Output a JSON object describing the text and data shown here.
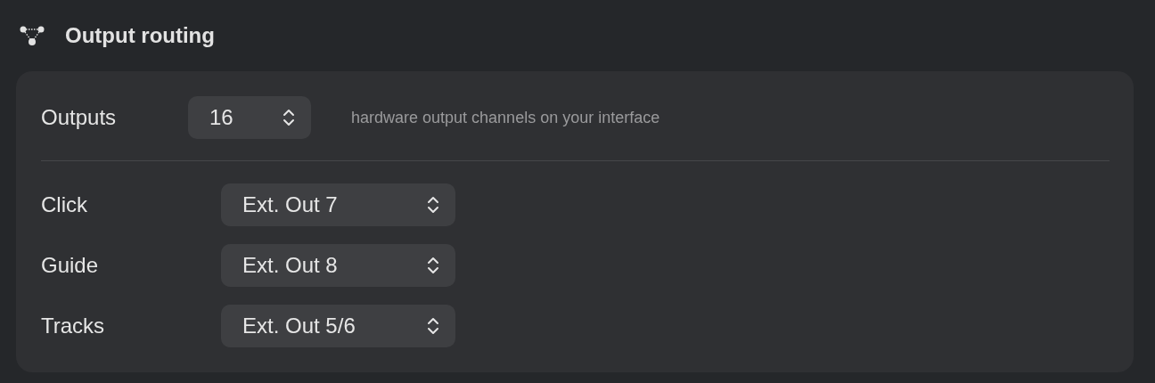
{
  "section": {
    "title": "Output routing"
  },
  "outputs": {
    "label": "Outputs",
    "value": "16",
    "hint": "hardware output channels on your interface"
  },
  "routes": [
    {
      "label": "Click",
      "value": "Ext. Out 7"
    },
    {
      "label": "Guide",
      "value": "Ext. Out 8"
    },
    {
      "label": "Tracks",
      "value": "Ext. Out 5/6"
    }
  ]
}
